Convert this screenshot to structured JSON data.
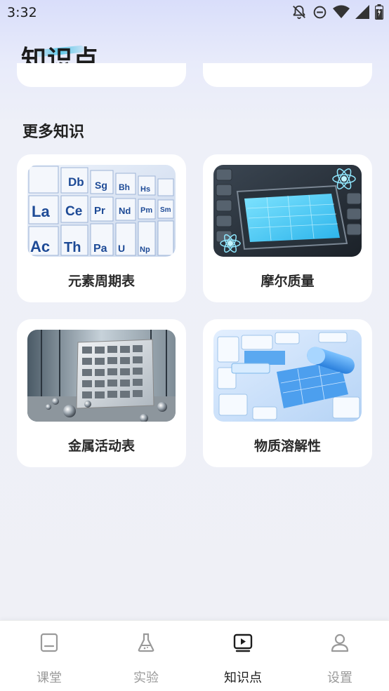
{
  "status_bar": {
    "time": "3:32",
    "icons": [
      "notifications-off-icon",
      "do-not-disturb-icon",
      "wifi-icon",
      "signal-icon",
      "battery-icon"
    ]
  },
  "header": {
    "title": "知识点"
  },
  "section": {
    "title": "更多知识"
  },
  "cards": [
    {
      "label": "元素周期表",
      "image": "periodic-table-image"
    },
    {
      "label": "摩尔质量",
      "image": "molar-mass-device-image"
    },
    {
      "label": "金属活动表",
      "image": "metal-activity-tablet-image"
    },
    {
      "label": "物质溶解性",
      "image": "solubility-chart-image"
    }
  ],
  "tab_bar": {
    "active": "知识点",
    "tabs": [
      {
        "label": "课堂",
        "icon": "book-icon"
      },
      {
        "label": "实验",
        "icon": "flask-icon"
      },
      {
        "label": "知识点",
        "icon": "video-play-icon"
      },
      {
        "label": "设置",
        "icon": "user-icon"
      }
    ]
  },
  "colors": {
    "accent": "#5cc7e6",
    "active_tab": "#1e1e1e",
    "inactive_tab": "#9a9a9a",
    "background": "#eff0f6"
  }
}
